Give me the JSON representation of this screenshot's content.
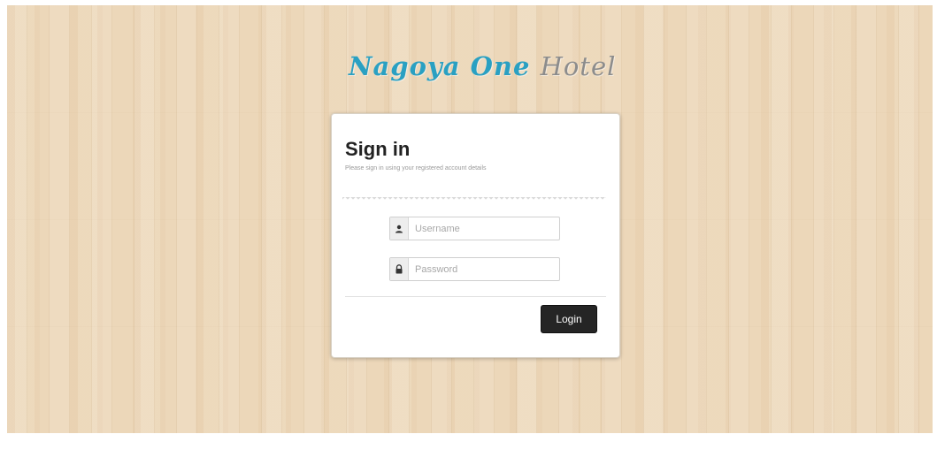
{
  "brand": {
    "name_part1": "Nagoya One",
    "name_part2": "Hotel",
    "color_primary": "#2aa0c2",
    "color_secondary": "#8c8c8c"
  },
  "signin": {
    "title": "Sign in",
    "subtitle": "Please sign in using your registered account details"
  },
  "form": {
    "username": {
      "placeholder": "Username",
      "value": "",
      "icon": "user-icon"
    },
    "password": {
      "placeholder": "Password",
      "value": "",
      "icon": "lock-icon"
    },
    "login_label": "Login"
  },
  "colors": {
    "background": "#ecd7b9",
    "button": "#252525"
  }
}
